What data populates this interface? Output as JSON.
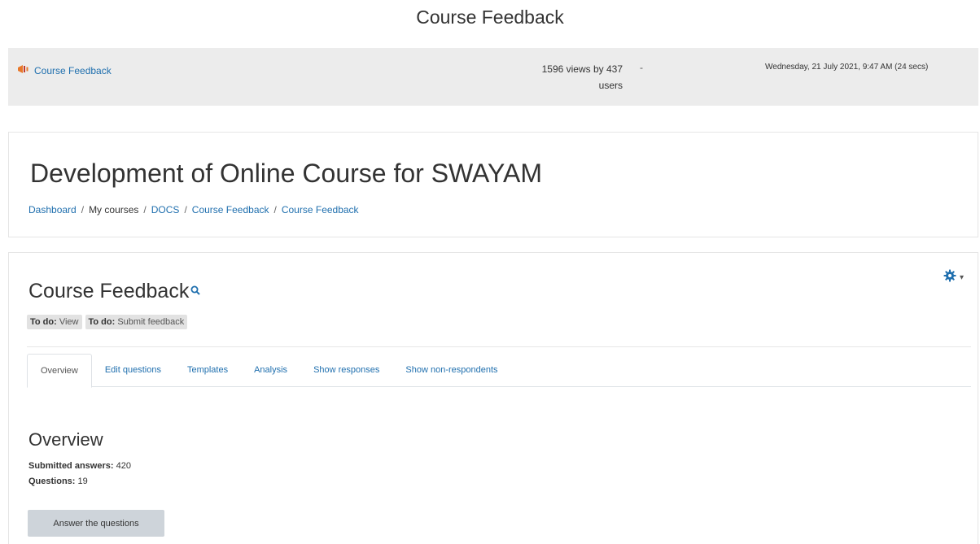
{
  "page": {
    "top_title": "Course Feedback"
  },
  "log": {
    "activity_link": "Course Feedback",
    "views_line1": "1596 views by 437",
    "views_line2": "users",
    "separator": "-",
    "last_access": "Wednesday, 21 July 2021, 9:47 AM (24 secs)"
  },
  "header": {
    "course_title": "Development of Online Course for SWAYAM",
    "breadcrumb": [
      {
        "label": "Dashboard",
        "link": true
      },
      {
        "label": "My courses",
        "link": false
      },
      {
        "label": "DOCS",
        "link": true
      },
      {
        "label": "Course Feedback",
        "link": true
      },
      {
        "label": "Course Feedback",
        "link": true
      }
    ],
    "breadcrumb_separator": "/"
  },
  "activity": {
    "title": "Course Feedback",
    "todo_badges": [
      {
        "prefix": "To do:",
        "text": "View"
      },
      {
        "prefix": "To do:",
        "text": "Submit feedback"
      }
    ],
    "tabs": [
      {
        "label": "Overview",
        "active": true
      },
      {
        "label": "Edit questions",
        "active": false
      },
      {
        "label": "Templates",
        "active": false
      },
      {
        "label": "Analysis",
        "active": false
      },
      {
        "label": "Show responses",
        "active": false
      },
      {
        "label": "Show non-respondents",
        "active": false
      }
    ]
  },
  "overview": {
    "heading": "Overview",
    "submitted_label": "Submitted answers:",
    "submitted_value": "420",
    "questions_label": "Questions:",
    "questions_value": "19",
    "answer_button": "Answer the questions"
  },
  "colors": {
    "link": "#1f6fae",
    "gear": "#1f6fae",
    "icon_orange": "#e8782a"
  },
  "icons": {
    "activity": "feedback-megaphone-icon",
    "zoom": "search-icon",
    "actions": "gear-icon"
  }
}
